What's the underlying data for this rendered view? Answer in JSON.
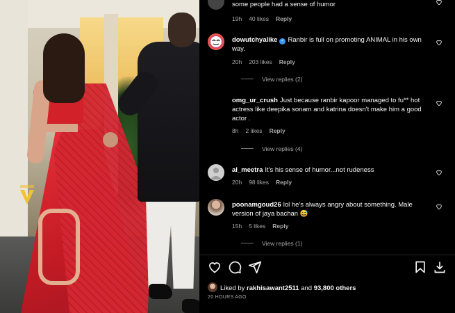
{
  "comments": [
    {
      "username": "",
      "text": "some people had a sense of humor",
      "time": "19h",
      "likes": "40 likes",
      "reply_label": "Reply",
      "verified": false
    },
    {
      "username": "dowutchyalike",
      "text": "Ranbir is full on promoting ANIMAL in his own way.",
      "time": "20h",
      "likes": "203 likes",
      "reply_label": "Reply",
      "verified": true,
      "view_replies": "View replies (2)"
    },
    {
      "username": "omg_ur_crush",
      "text": "Just because ranbir kapoor managed to fu** hot actress like deepika sonam and katrina doesn't make him a good actor .",
      "time": "8h",
      "likes": "2 likes",
      "reply_label": "Reply",
      "verified": false,
      "view_replies": "View replies (4)"
    },
    {
      "username": "al_meetra",
      "text": "It's his sense of humor...not rudeness",
      "time": "20h",
      "likes": "98 likes",
      "reply_label": "Reply",
      "verified": false
    },
    {
      "username": "poonamgoud26",
      "text": "lol he's always angry about something. Male version of jaya bachan 😅",
      "time": "15h",
      "likes": "5 likes",
      "reply_label": "Reply",
      "verified": false,
      "view_replies": "View replies (1)"
    }
  ],
  "actions": [
    "heart-icon",
    "comment-icon",
    "share-icon",
    "bookmark-icon",
    "download-icon"
  ],
  "liked_by": {
    "prefix": "Liked by",
    "user": "rakhisawant2511",
    "middle": "and",
    "others": "93,800 others"
  },
  "time_ago": "20 HOURS AGO",
  "colors": {
    "background": "#000000",
    "text": "#f5f5f5",
    "muted": "#a8a8a8",
    "verified": "#3897f0"
  }
}
